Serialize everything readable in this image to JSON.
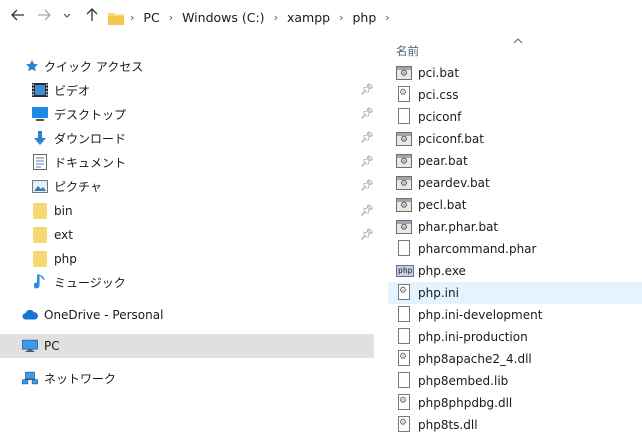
{
  "address": {
    "crumbs": [
      "PC",
      "Windows (C:)",
      "xampp",
      "php"
    ]
  },
  "nav": {
    "quick_access": "クイック アクセス",
    "items": [
      {
        "label": "ビデオ",
        "pinned": true,
        "icon": "video-icon"
      },
      {
        "label": "デスクトップ",
        "pinned": true,
        "icon": "desktop-icon"
      },
      {
        "label": "ダウンロード",
        "pinned": true,
        "icon": "download-icon"
      },
      {
        "label": "ドキュメント",
        "pinned": true,
        "icon": "document-icon"
      },
      {
        "label": "ピクチャ",
        "pinned": true,
        "icon": "picture-icon"
      },
      {
        "label": "bin",
        "pinned": true,
        "icon": "folder-icon"
      },
      {
        "label": "ext",
        "pinned": true,
        "icon": "folder-icon"
      },
      {
        "label": "php",
        "pinned": false,
        "icon": "folder-icon"
      },
      {
        "label": "ミュージック",
        "pinned": false,
        "icon": "music-icon"
      }
    ],
    "onedrive": "OneDrive - Personal",
    "pc": "PC",
    "network": "ネットワーク"
  },
  "filelist": {
    "column_name": "名前",
    "files": [
      {
        "name": "pci.bat",
        "icon": "bat"
      },
      {
        "name": "pci.css",
        "icon": "gear-doc"
      },
      {
        "name": "pciconf",
        "icon": "doc"
      },
      {
        "name": "pciconf.bat",
        "icon": "bat"
      },
      {
        "name": "pear.bat",
        "icon": "bat"
      },
      {
        "name": "peardev.bat",
        "icon": "bat"
      },
      {
        "name": "pecl.bat",
        "icon": "bat"
      },
      {
        "name": "phar.phar.bat",
        "icon": "bat"
      },
      {
        "name": "pharcommand.phar",
        "icon": "doc"
      },
      {
        "name": "php.exe",
        "icon": "php"
      },
      {
        "name": "php.ini",
        "icon": "gear-doc"
      },
      {
        "name": "php.ini-development",
        "icon": "doc"
      },
      {
        "name": "php.ini-production",
        "icon": "doc"
      },
      {
        "name": "php8apache2_4.dll",
        "icon": "gear-doc"
      },
      {
        "name": "php8embed.lib",
        "icon": "doc"
      },
      {
        "name": "php8phpdbg.dll",
        "icon": "gear-doc"
      },
      {
        "name": "php8ts.dll",
        "icon": "gear-doc"
      }
    ],
    "hover_index": 10
  },
  "icon_glyphs": {
    "php_label": "php"
  }
}
